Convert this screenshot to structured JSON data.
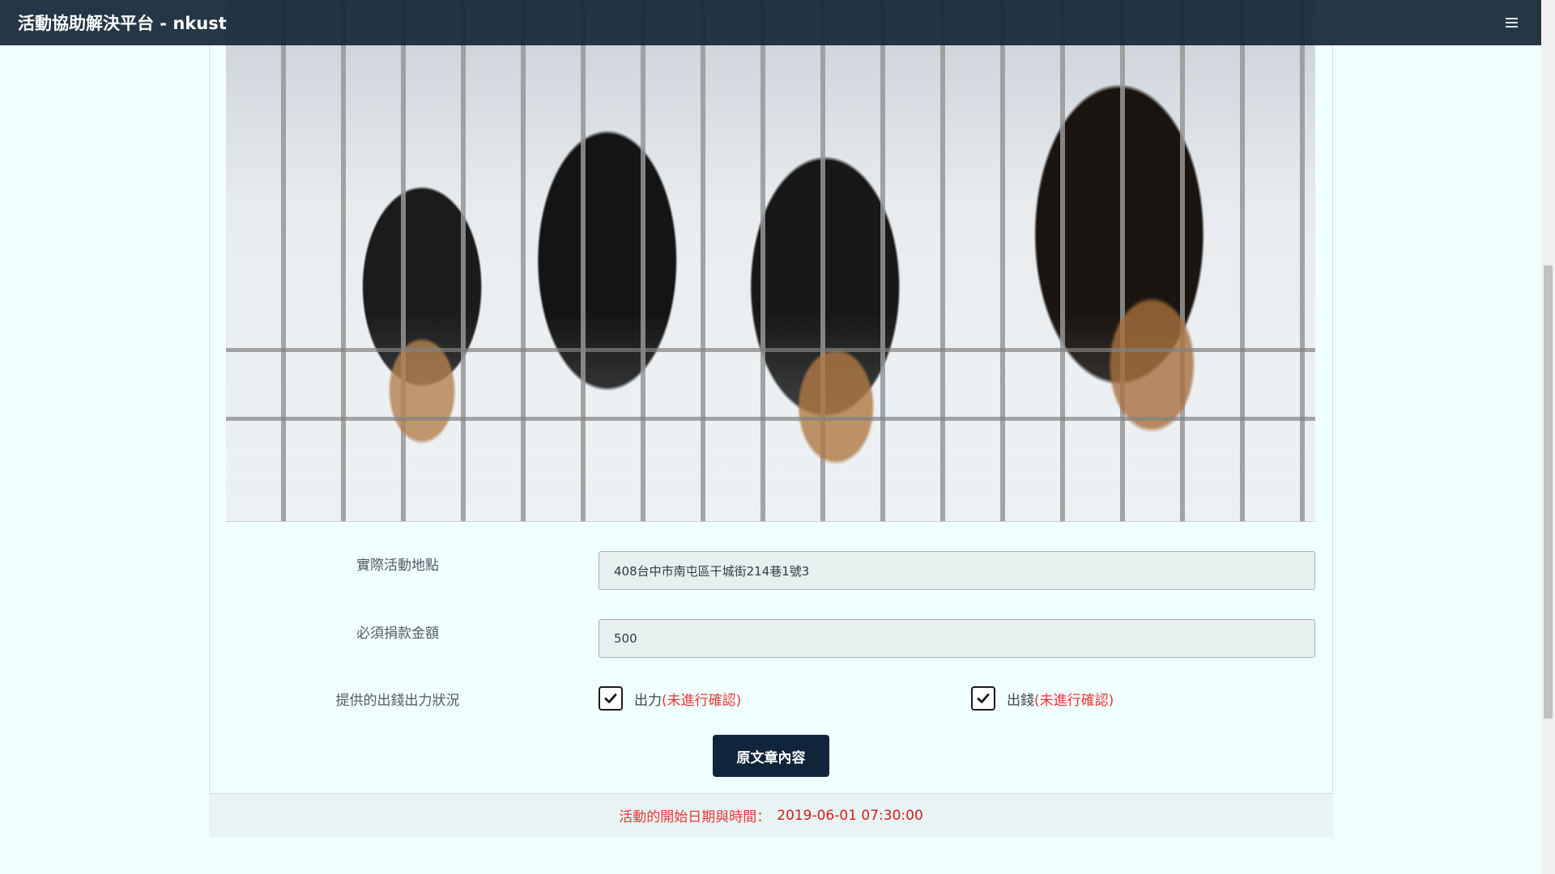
{
  "app": {
    "title": "活動協助解決平台 - nkust",
    "menu_icon": "hamburger-menu-icon"
  },
  "activity": {
    "photo_description": "puppies-in-cage-photo",
    "location_label": "實際活動地點",
    "location_value": "408台中市南屯區干城街214巷1號3",
    "donation_label": "必須捐款金額",
    "donation_value": "500",
    "contribution_label": "提供的出錢出力狀況",
    "effort_option": "出力",
    "effort_status": "(未進行確認)",
    "money_option": "出錢",
    "money_status": "(未進行確認)",
    "effort_checked": true,
    "money_checked": true,
    "original_button": "原文章內容"
  },
  "footer": {
    "start_label": "活動的開始日期與時間：",
    "start_datetime": "2019-06-01 07:30:00"
  },
  "colors": {
    "navbar": "#162838",
    "page_bg": "#f0ffff",
    "button": "#10253b",
    "status_red": "#e53935"
  }
}
